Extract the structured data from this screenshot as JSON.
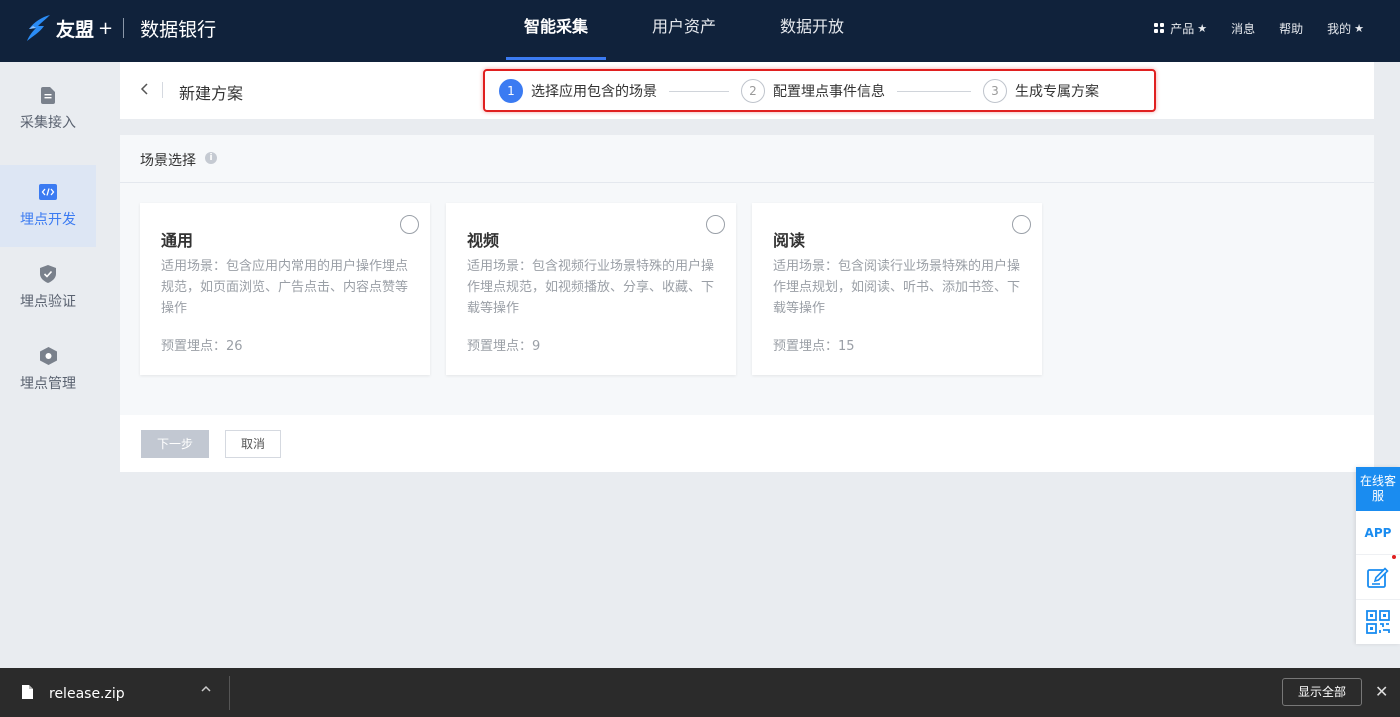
{
  "topbar": {
    "brand_name": "友盟",
    "brand_plus": "+",
    "product_name": "数据银行",
    "nav": [
      "智能采集",
      "用户资产",
      "数据开放"
    ],
    "right": {
      "products": "产品",
      "star": "★",
      "messages": "消息",
      "help": "帮助",
      "mine": "我的"
    }
  },
  "sidebar": {
    "items": [
      {
        "label": "采集接入",
        "icon": "document-icon"
      },
      {
        "label": "埋点开发",
        "icon": "code-icon"
      },
      {
        "label": "埋点验证",
        "icon": "shield-check-icon"
      },
      {
        "label": "埋点管理",
        "icon": "hexagon-gear-icon"
      }
    ]
  },
  "header": {
    "back": "<",
    "title": "新建方案",
    "steps": [
      {
        "num": "1",
        "label": "选择应用包含的场景"
      },
      {
        "num": "2",
        "label": "配置埋点事件信息"
      },
      {
        "num": "3",
        "label": "生成专属方案"
      }
    ]
  },
  "section": {
    "title": "场景选择",
    "info": "i"
  },
  "scenes": [
    {
      "title": "通用",
      "desc": "适用场景：包含应用内常用的用户操作埋点规范，如页面浏览、广告点击、内容点赞等操作",
      "count": "预置埋点：26"
    },
    {
      "title": "视频",
      "desc": "适用场景：包含视频行业场景特殊的用户操作埋点规范，如视频播放、分享、收藏、下载等操作",
      "count": "预置埋点：9"
    },
    {
      "title": "阅读",
      "desc": "适用场景：包含阅读行业场景特殊的用户操作埋点规划，如阅读、听书、添加书签、下载等操作",
      "count": "预置埋点：15"
    }
  ],
  "footer": {
    "next": "下一步",
    "cancel": "取消"
  },
  "float": {
    "chat": "在线客服",
    "app": "APP"
  },
  "download": {
    "file": "release.zip",
    "show_all": "显示全部",
    "close": "✕",
    "chevron": "︿"
  },
  "colors": {
    "topbar_bg": "#10223b",
    "accent": "#3b7bf2",
    "highlight_border": "#e02020"
  }
}
